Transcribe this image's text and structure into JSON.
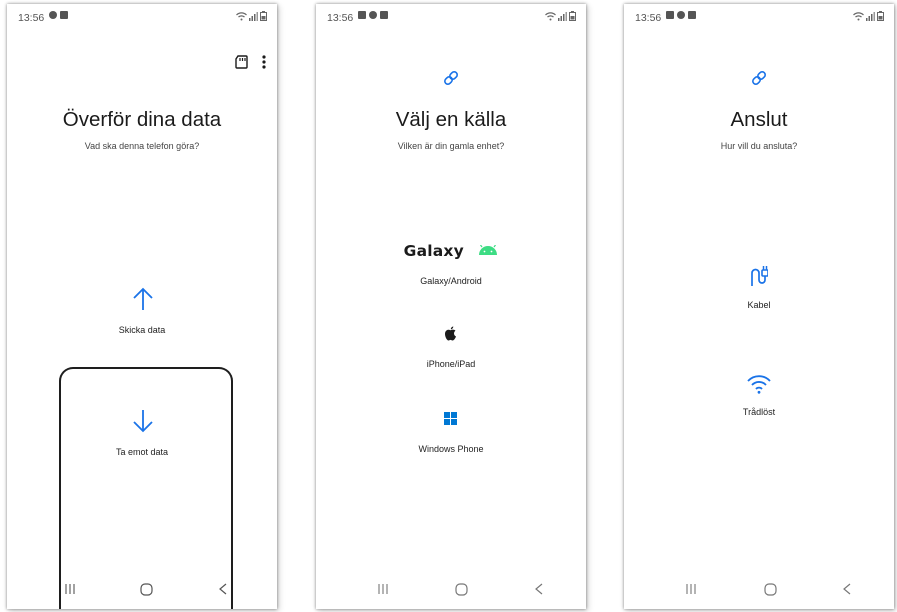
{
  "status_bar": {
    "time": "13:56"
  },
  "screens": [
    {
      "title": "Överför dina data",
      "subtitle": "Vad ska denna telefon göra?",
      "options": [
        {
          "label": "Skicka data",
          "icon": "arrow-up-icon"
        },
        {
          "label": "Ta emot data",
          "icon": "arrow-down-icon"
        }
      ],
      "top_actions": [
        "sd-card-icon",
        "more-options-icon"
      ]
    },
    {
      "title": "Välj en källa",
      "subtitle": "Vilken är din gamla enhet?",
      "header_icon": "link-icon",
      "options": [
        {
          "label": "Galaxy/Android",
          "logo_text": "Galaxy",
          "icon": "android-icon"
        },
        {
          "label": "iPhone/iPad",
          "icon": "apple-icon"
        },
        {
          "label": "Windows Phone",
          "icon": "windows-icon"
        }
      ]
    },
    {
      "title": "Anslut",
      "subtitle": "Hur vill du ansluta?",
      "header_icon": "link-icon",
      "options": [
        {
          "label": "Kabel",
          "icon": "cable-icon"
        },
        {
          "label": "Trådlöst",
          "icon": "wifi-icon"
        }
      ]
    }
  ],
  "nav_bar": [
    "recent-apps-icon",
    "home-icon",
    "back-icon"
  ],
  "colors": {
    "accent": "#1a73e8",
    "text": "#1b1b1b",
    "android_green": "#3ddc84",
    "windows_blue": "#0078d4"
  }
}
